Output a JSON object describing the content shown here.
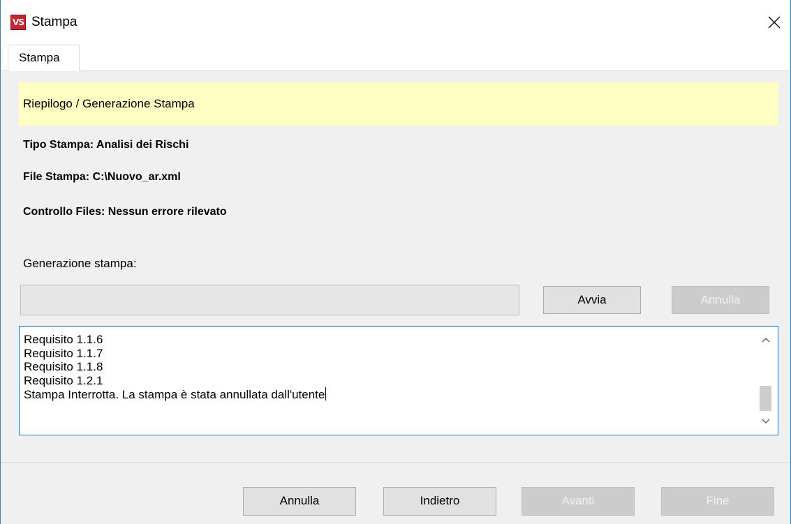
{
  "window": {
    "title": "Stampa",
    "icon_text": "VS",
    "icon_color": "#c9252c"
  },
  "tabs": [
    {
      "label": "Stampa",
      "selected": true
    }
  ],
  "banner": {
    "text": "Riepilogo / Generazione Stampa",
    "color": "#ffffc4"
  },
  "info": {
    "tipo_stampa": "Tipo Stampa: Analisi dei Rischi",
    "file_stampa": "File Stampa: C:\\Nuovo_ar.xml",
    "controllo_files": "Controllo Files: Nessun errore rilevato"
  },
  "generation": {
    "label": "Generazione stampa:",
    "progress": 0,
    "start_button": "Avvia",
    "cancel_button": "Annulla",
    "cancel_enabled": false
  },
  "log": {
    "lines": [
      "Requisito 1.1.6",
      "Requisito 1.1.7",
      "Requisito 1.1.8",
      "Requisito 1.2.1",
      "Stampa Interrotta. La stampa è stata annullata dall'utente"
    ]
  },
  "footer": {
    "annulla": "Annulla",
    "indietro": "Indietro",
    "avanti": "Avanti",
    "fine": "Fine",
    "avanti_enabled": false,
    "fine_enabled": false
  }
}
